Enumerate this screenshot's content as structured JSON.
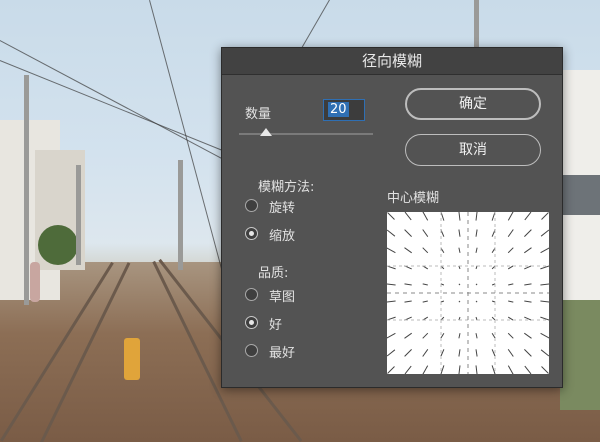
{
  "dialog": {
    "title": "径向模糊",
    "amount_label": "数量",
    "amount_value": "20",
    "amount_slider_fraction": 0.2,
    "ok_label": "确定",
    "cancel_label": "取消",
    "method": {
      "label": "模糊方法:",
      "options": [
        "旋转",
        "缩放"
      ],
      "selected": "缩放"
    },
    "quality": {
      "label": "品质:",
      "options": [
        "草图",
        "好",
        "最好"
      ],
      "selected": "好"
    },
    "preview_label": "中心模糊"
  },
  "colors": {
    "dialog_bg": "#535353",
    "titlebar_bg": "#424242",
    "input_focus": "#2f6fb3"
  },
  "icons": [
    "radio-button",
    "slider-thumb-triangle"
  ]
}
